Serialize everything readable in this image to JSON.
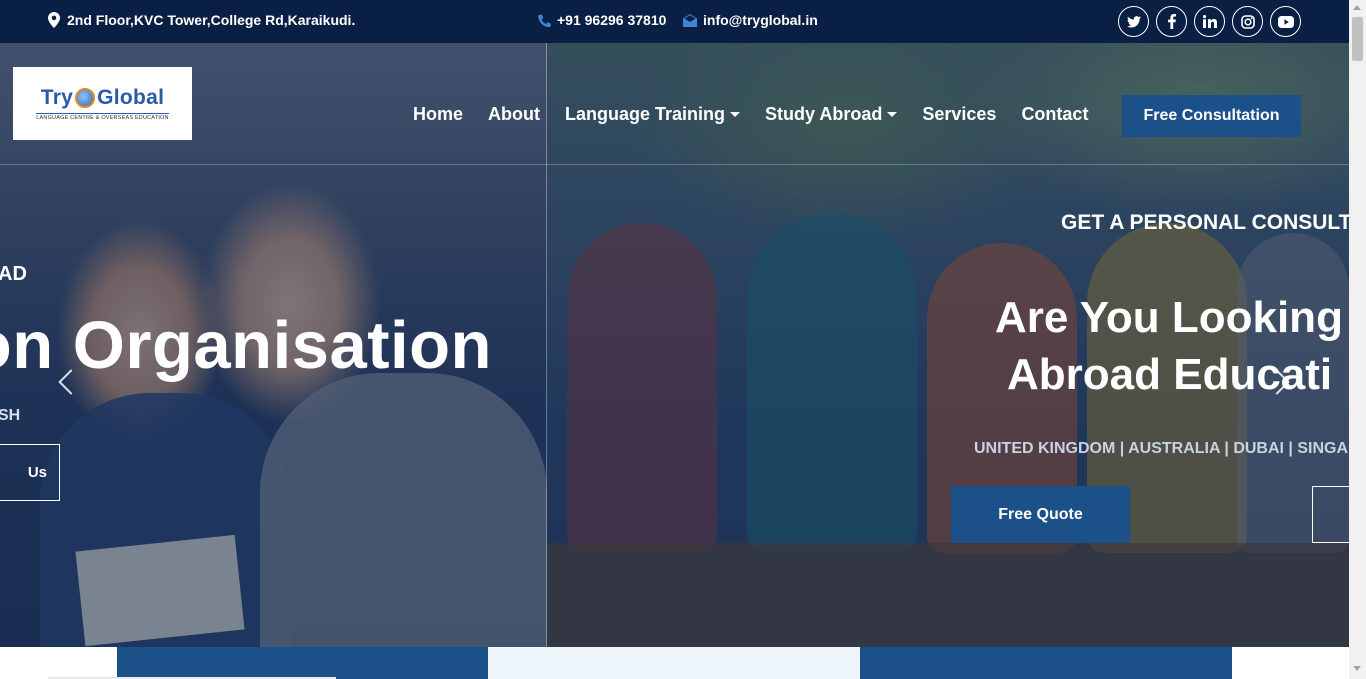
{
  "topbar": {
    "address": "2nd Floor,KVC Tower,College Rd,Karaikudi.",
    "phone": "+91 96296 37810",
    "email": "info@tryglobal.in",
    "socials": [
      {
        "name": "twitter",
        "glyph": "t"
      },
      {
        "name": "facebook",
        "glyph": "f"
      },
      {
        "name": "linkedin",
        "glyph": "in"
      },
      {
        "name": "instagram",
        "glyph": "◎"
      },
      {
        "name": "youtube",
        "glyph": "▶"
      }
    ]
  },
  "logo": {
    "title_left": "Try",
    "title_right": "Global",
    "tagline": "LANGUAGE CENTRE & OVERSEAS EDUCATION"
  },
  "nav": {
    "items": [
      {
        "label": "Home"
      },
      {
        "label": "About"
      },
      {
        "label": "Language Training"
      },
      {
        "label": "Study Abroad"
      },
      {
        "label": "Services"
      },
      {
        "label": "Contact"
      }
    ],
    "cta": "Free Consultation"
  },
  "slide_left": {
    "kicker": "AD",
    "title": "on Organisation",
    "subtitle": "SH",
    "button": "Us"
  },
  "slide_right": {
    "kicker": "GET A PERSONAL CONSULTAN",
    "title_line1": "Are You Looking",
    "title_line2": "Abroad Educati",
    "countries": "UNITED KINGDOM | AUSTRALIA | DUBAI | SINGAP",
    "button": "Free Quote"
  },
  "colors": {
    "topbar_bg": "#0a1f44",
    "brand_blue": "#1c5089",
    "logo_blue": "#2a5aa8",
    "logo_orange": "#e48a1a"
  }
}
